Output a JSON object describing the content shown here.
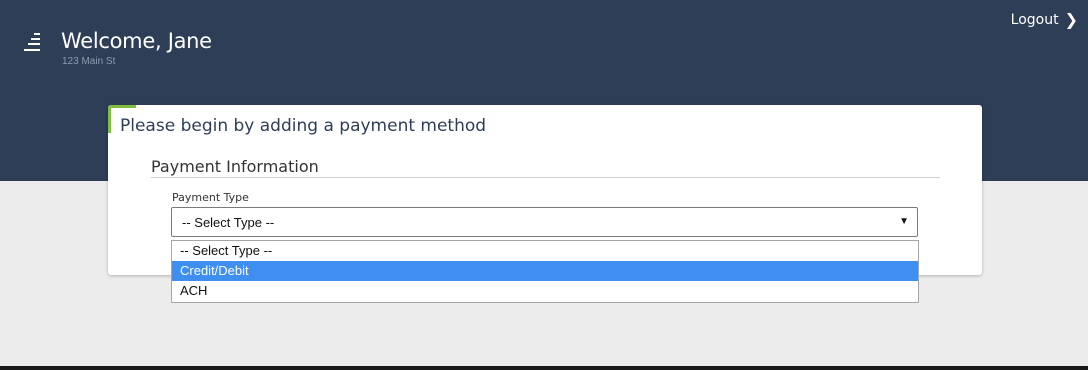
{
  "header": {
    "welcome": "Welcome, Jane",
    "address": "123 Main St",
    "logout_label": "Logout",
    "menu_icon": "menu-icon",
    "logout_icon": "chevron-right-icon"
  },
  "card": {
    "title": "Please begin by adding a payment method",
    "section_title": "Payment Information",
    "accent_color": "#7fbe3f"
  },
  "payment_type": {
    "label": "Payment Type",
    "selected": "-- Select Type --",
    "options": [
      "-- Select Type --",
      "Credit/Debit",
      "ACH"
    ],
    "highlighted_option": "Credit/Debit"
  },
  "colors": {
    "header_bg": "#2e3e57",
    "page_bg": "#ececec",
    "highlight": "#3f8ff0"
  }
}
